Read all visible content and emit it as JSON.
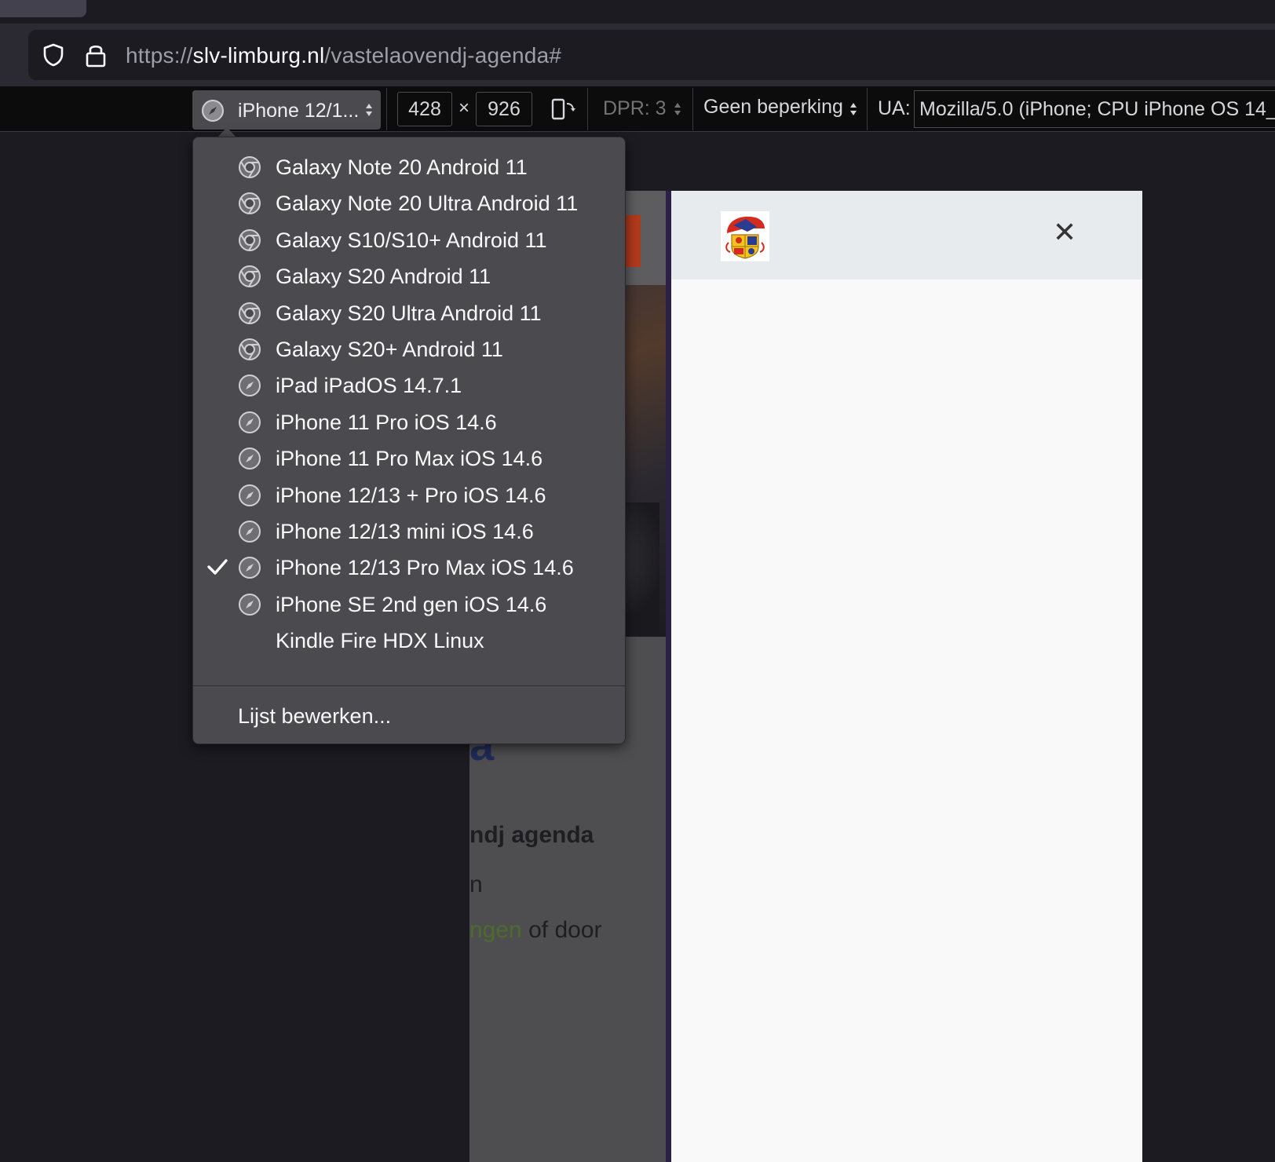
{
  "browser": {
    "url_scheme": "https://",
    "url_host": "slv-limburg.nl",
    "url_path": "/vastelaovendj-agenda#"
  },
  "rdm": {
    "device_label": "iPhone 12/1...",
    "width": "428",
    "times": "×",
    "height": "926",
    "dpr": "DPR: 3",
    "throttling": "Geen beperking",
    "ua_label": "UA:",
    "ua_value": "Mozilla/5.0 (iPhone; CPU iPhone OS 14_6"
  },
  "device_menu": {
    "items": [
      {
        "label": "Galaxy Note 20 Android 11",
        "icon": "chrome-icon",
        "checked": false
      },
      {
        "label": "Galaxy Note 20 Ultra Android 11",
        "icon": "chrome-icon",
        "checked": false
      },
      {
        "label": "Galaxy S10/S10+ Android 11",
        "icon": "chrome-icon",
        "checked": false
      },
      {
        "label": "Galaxy S20 Android 11",
        "icon": "chrome-icon",
        "checked": false
      },
      {
        "label": "Galaxy S20 Ultra Android 11",
        "icon": "chrome-icon",
        "checked": false
      },
      {
        "label": "Galaxy S20+ Android 11",
        "icon": "chrome-icon",
        "checked": false
      },
      {
        "label": "iPad iPadOS 14.7.1",
        "icon": "safari-icon",
        "checked": false
      },
      {
        "label": "iPhone 11 Pro iOS 14.6",
        "icon": "safari-icon",
        "checked": false
      },
      {
        "label": "iPhone 11 Pro Max iOS 14.6",
        "icon": "safari-icon",
        "checked": false
      },
      {
        "label": "iPhone 12/13 + Pro iOS 14.6",
        "icon": "safari-icon",
        "checked": false
      },
      {
        "label": "iPhone 12/13 mini iOS 14.6",
        "icon": "safari-icon",
        "checked": false
      },
      {
        "label": "iPhone 12/13 Pro Max iOS 14.6",
        "icon": "safari-icon",
        "checked": true
      },
      {
        "label": "iPhone SE 2nd gen iOS 14.6",
        "icon": "safari-icon",
        "checked": false
      },
      {
        "label": "Kindle Fire HDX Linux",
        "icon": "",
        "checked": false
      }
    ],
    "edit_label": "Lijst bewerken..."
  },
  "page": {
    "h1_fragment": "a",
    "h2_fragment": "ndj agenda",
    "p_fragment": "n",
    "link_fragment": "ngen",
    "p2_fragment": " of door"
  },
  "panel": {
    "close_glyph": "✕"
  },
  "colors": {
    "menu_bg": "#4a4a4f",
    "toolbar_bg": "#0c0c0d",
    "panel_head": "#e8ebed"
  }
}
